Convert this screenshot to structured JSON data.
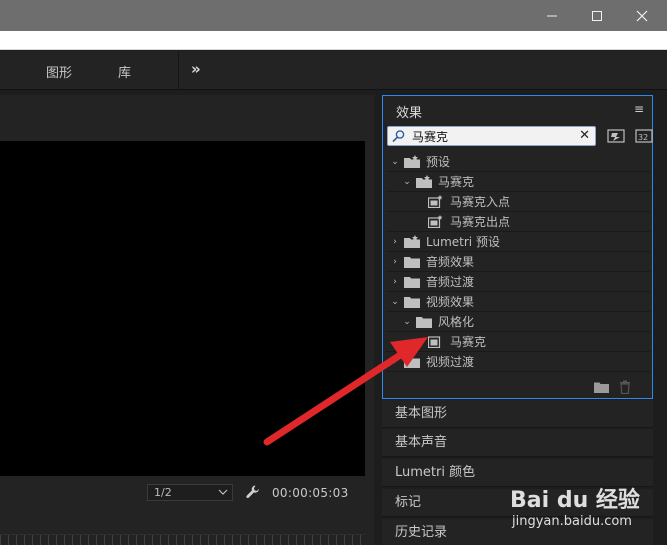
{
  "tabs": [
    {
      "label": "图形"
    },
    {
      "label": "库"
    }
  ],
  "tab_overflow": "»",
  "monitor": {
    "zoom": "1/2",
    "timecode": "00:00:05:03"
  },
  "effects": {
    "title": "效果",
    "search_value": "马赛克",
    "tree": [
      {
        "label": "预设"
      },
      {
        "label": "马赛克"
      },
      {
        "label": "马赛克入点"
      },
      {
        "label": "马赛克出点"
      },
      {
        "label": "Lumetri 预设"
      },
      {
        "label": "音频效果"
      },
      {
        "label": "音频过渡"
      },
      {
        "label": "视频效果"
      },
      {
        "label": "风格化"
      },
      {
        "label": "马赛克"
      },
      {
        "label": "视频过渡"
      }
    ]
  },
  "panels": [
    {
      "label": "基本图形"
    },
    {
      "label": "基本声音"
    },
    {
      "label": "Lumetri 颜色"
    },
    {
      "label": "标记"
    },
    {
      "label": "历史记录"
    }
  ],
  "watermark": {
    "brand": "Bai du 经验",
    "url": "jingyan.baidu.com"
  },
  "colors": {
    "accent_border": "#2d8ceb",
    "arrow": "#e0282a",
    "panel_bg": "#232323"
  }
}
